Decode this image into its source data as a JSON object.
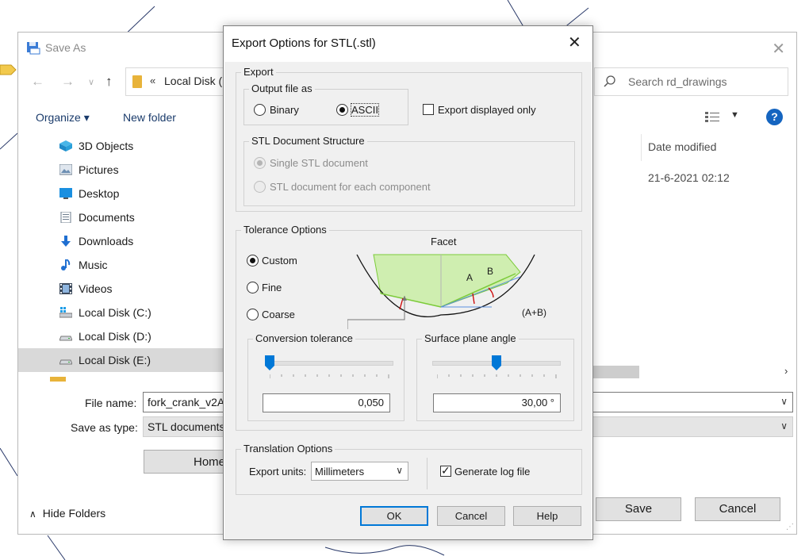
{
  "save_as": {
    "title": "Save As",
    "address_path": "Local Disk (",
    "search_placeholder": "Search rd_drawings",
    "toolbar": {
      "organize": "Organize ▾",
      "new_folder": "New folder"
    },
    "nav_items": [
      {
        "label": "3D Objects",
        "icon": "3d-objects-icon"
      },
      {
        "label": "Pictures",
        "icon": "pictures-icon"
      },
      {
        "label": "Desktop",
        "icon": "desktop-icon"
      },
      {
        "label": "Documents",
        "icon": "documents-icon"
      },
      {
        "label": "Downloads",
        "icon": "downloads-icon"
      },
      {
        "label": "Music",
        "icon": "music-icon"
      },
      {
        "label": "Videos",
        "icon": "videos-icon"
      },
      {
        "label": "Local Disk (C:)",
        "icon": "drive-icon"
      },
      {
        "label": "Local Disk (D:)",
        "icon": "drive-icon"
      },
      {
        "label": "Local Disk (E:)",
        "icon": "drive-icon",
        "selected": true
      }
    ],
    "column_date_modified": "Date modified",
    "row_date": "21-6-2021 02:12",
    "file_name_label": "File name:",
    "file_name_value": "fork_crank_v2A",
    "save_as_type_label": "Save as type:",
    "save_as_type_value": "STL documents",
    "home_button": "Home",
    "hide_folders": "Hide Folders",
    "save_button": "Save",
    "cancel_button": "Cancel"
  },
  "dialog": {
    "title": "Export Options for STL(.stl)",
    "export_group": "Export",
    "output_file_as": "Output file as",
    "binary": "Binary",
    "ascii": "ASCII",
    "output_selected": "ASCII",
    "export_displayed_only": "Export displayed only",
    "export_displayed_only_checked": false,
    "stl_structure_group": "STL Document Structure",
    "single_stl": "Single STL document",
    "stl_each_component": "STL document for each component",
    "tolerance_group": "Tolerance Options",
    "tolerance_custom": "Custom",
    "tolerance_fine": "Fine",
    "tolerance_coarse": "Coarse",
    "tolerance_selected": "Custom",
    "facet_label": "Facet",
    "label_a": "A",
    "label_b": "B",
    "label_a_plus_b": "(A+B)",
    "conversion_tolerance": "Conversion tolerance",
    "conversion_tolerance_value": "0,050",
    "conversion_slider_fraction": 0.05,
    "surface_plane_angle": "Surface plane angle",
    "surface_plane_angle_value": "30,00 °",
    "surface_slider_fraction": 0.5,
    "translation_group": "Translation Options",
    "export_units_label": "Export units:",
    "export_units_value": "Millimeters",
    "generate_log_file": "Generate log file",
    "generate_log_file_checked": true,
    "ok": "OK",
    "cancel": "Cancel",
    "help": "Help"
  },
  "colors": {
    "accent": "#0078d7",
    "facet_fill": "#cfeeb0",
    "facet_edge": "#7ccb3a",
    "arc_red": "#cc0000"
  }
}
